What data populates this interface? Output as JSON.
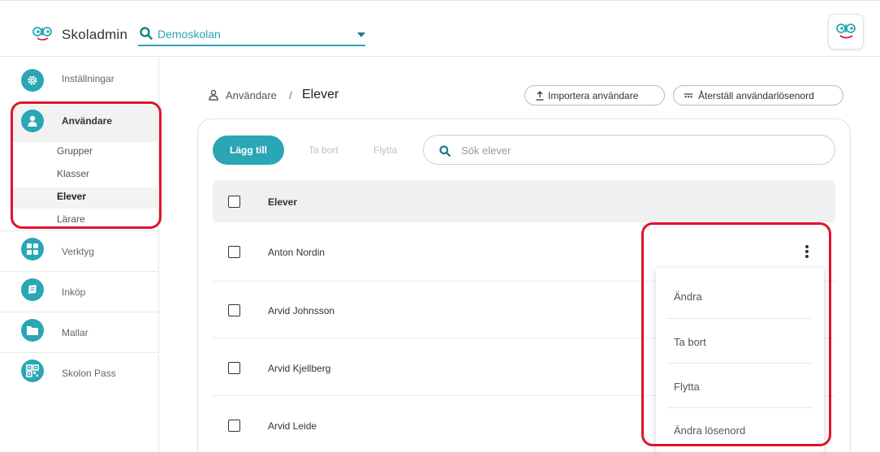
{
  "header": {
    "app_title": "Skoladmin",
    "school": "Demoskolan",
    "brand_color": "#2aa6b5"
  },
  "sidebar": {
    "items": [
      {
        "label": "Inställningar",
        "icon": "gear-icon"
      },
      {
        "label": "Användare",
        "icon": "user-icon"
      },
      {
        "label": "Verktyg",
        "icon": "grid-icon"
      },
      {
        "label": "Inköp",
        "icon": "book-icon"
      },
      {
        "label": "Mallar",
        "icon": "folder-icon"
      },
      {
        "label": "Skolon Pass",
        "icon": "qr-icon"
      }
    ],
    "subitems": [
      "Grupper",
      "Klasser",
      "Elever",
      "Lärare"
    ],
    "active_subitem": "Elever"
  },
  "breadcrumb": {
    "parent": "Användare",
    "separator": "/",
    "current": "Elever"
  },
  "actions": {
    "import": "Importera användare",
    "reset_passwords": "Återställ användarlösenord"
  },
  "toolbar": {
    "add": "Lägg till",
    "remove": "Ta bort",
    "move": "Flytta",
    "search_placeholder": "Sök elever"
  },
  "table": {
    "header": "Elever",
    "rows": [
      "Anton Nordin",
      "Arvid Johnsson",
      "Arvid Kjellberg",
      "Arvid Leide"
    ]
  },
  "context_menu": {
    "items": [
      "Ändra",
      "Ta bort",
      "Flytta",
      "Ändra lösenord"
    ]
  },
  "annotation_color": "#e0142b"
}
